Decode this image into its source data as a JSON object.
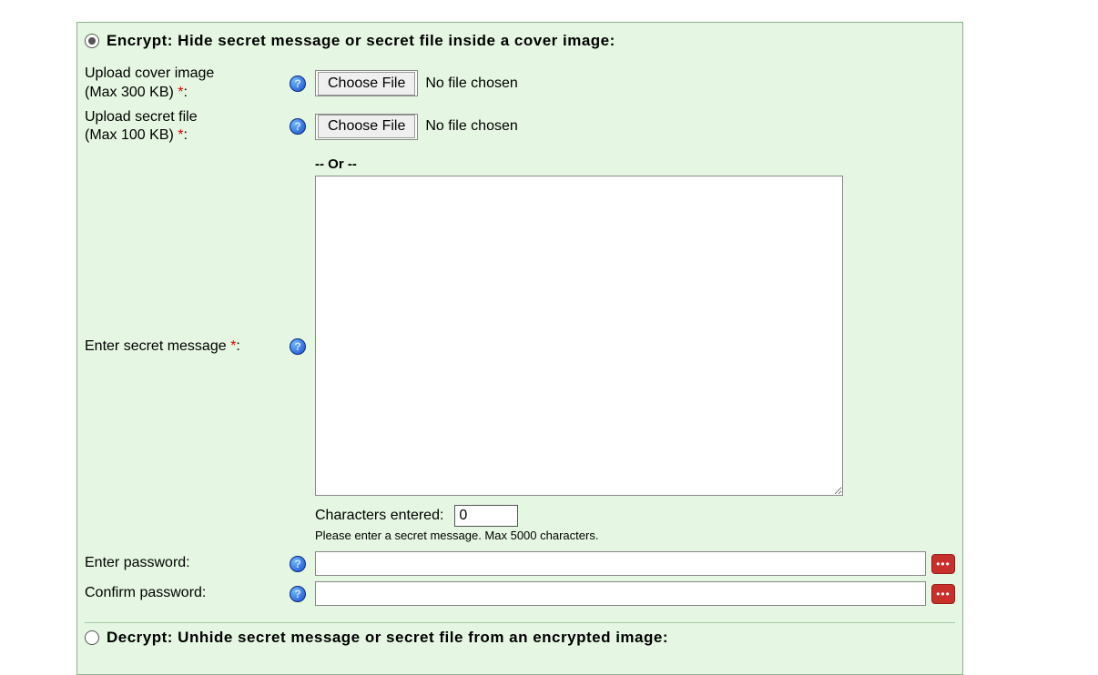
{
  "encrypt": {
    "title": "Encrypt: Hide secret message or secret file inside a cover image:",
    "selected": true,
    "cover": {
      "label_line1": "Upload cover image",
      "label_line2": "(Max 300 KB) ",
      "choose": "Choose File",
      "status": "No file chosen"
    },
    "secretFile": {
      "label_line1": "Upload secret file",
      "label_line2": "(Max 100 KB) ",
      "choose": "Choose File",
      "status": "No file chosen"
    },
    "or": "-- Or --",
    "secretMessage": {
      "label": "Enter secret message ",
      "value": "",
      "charLabel": "Characters entered:",
      "charCount": "0",
      "hint": "Please enter a secret message. Max 5000 characters."
    },
    "password": {
      "enterLabel": "Enter password:",
      "confirmLabel": "Confirm password:"
    }
  },
  "decrypt": {
    "title": "Decrypt: Unhide secret message or secret file from an encrypted image:",
    "selected": false
  },
  "glyphs": {
    "help": "?",
    "required": "*",
    "dots": "•••"
  }
}
